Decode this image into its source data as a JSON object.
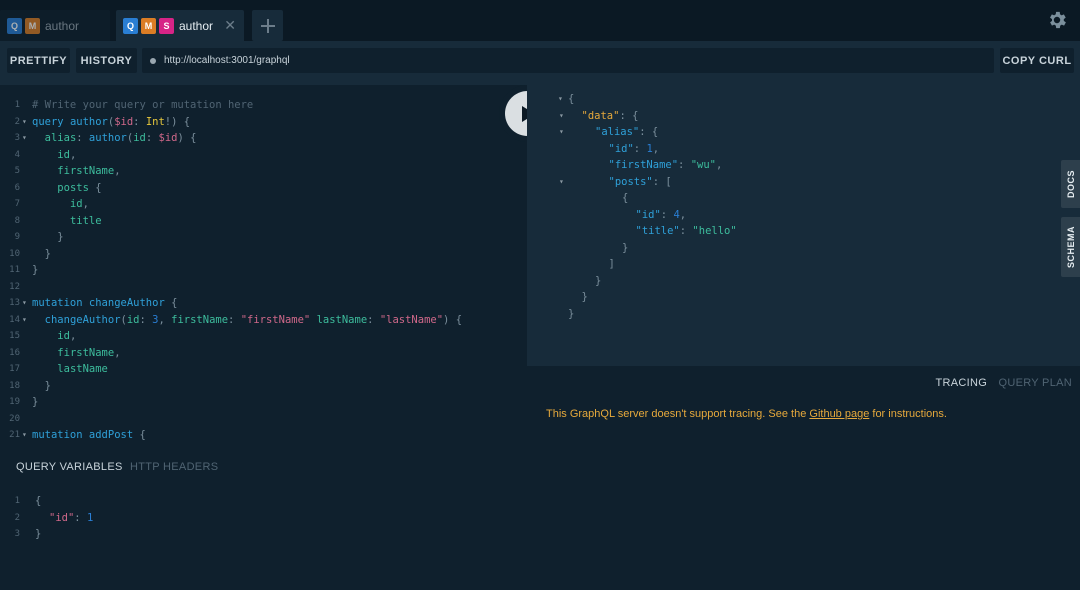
{
  "tabs": [
    {
      "badges": [
        "Q",
        "M"
      ],
      "label": "author",
      "active": false
    },
    {
      "badges": [
        "Q",
        "M",
        "S"
      ],
      "label": "author",
      "active": true
    }
  ],
  "toolbar": {
    "prettify": "PRETTIFY",
    "history": "HISTORY",
    "url": "http://localhost:3001/graphql",
    "copy_curl": "COPY CURL"
  },
  "side_tabs": {
    "docs": "DOCS",
    "schema": "SCHEMA"
  },
  "tracing": {
    "tab_tracing": "TRACING",
    "tab_query_plan": "QUERY PLAN",
    "msg_before": "This GraphQL server doesn't support tracing. See the ",
    "msg_link": "Github page",
    "msg_after": " for instructions."
  },
  "variables": {
    "tab_query_variables": "QUERY VARIABLES",
    "tab_http_headers": "HTTP HEADERS"
  },
  "query_lines": [
    "# Write your query or mutation here",
    "query author($id: Int!) {",
    "  alias: author(id: $id) {",
    "    id,",
    "    firstName,",
    "    posts {",
    "      id,",
    "      title",
    "    }",
    "  }",
    "}",
    "",
    "mutation changeAuthor {",
    "  changeAuthor(id: 3, firstName: \"firstName\" lastName: \"lastName\") {",
    "    id,",
    "    firstName,",
    "    lastName",
    "  }",
    "}",
    "",
    "mutation addPost {"
  ],
  "result_lines": [
    "{",
    "\"data\": {",
    "\"alias\": {",
    "\"id\": 1,",
    "\"firstName\": \"wu\",",
    "\"posts\": [",
    "{",
    "\"id\": 4,",
    "\"title\": \"hello\"",
    "}",
    "]",
    "}",
    "}",
    "}"
  ],
  "variables_lines": [
    "{",
    "\"id\": 1",
    "}"
  ]
}
